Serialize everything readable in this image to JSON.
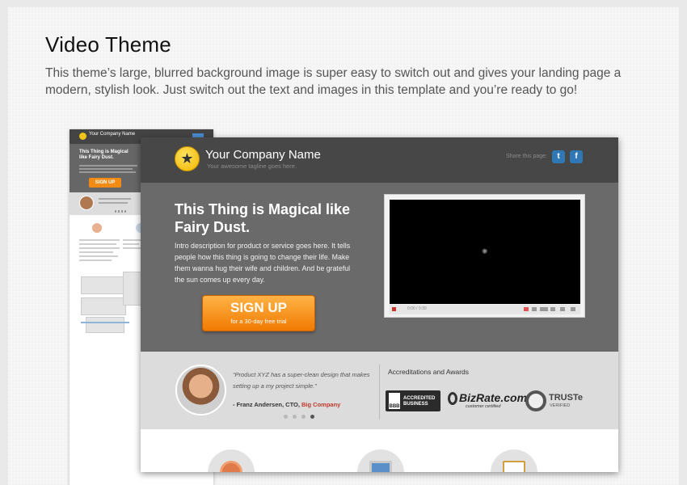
{
  "heading": "Video Theme",
  "description": "This theme’s large, blurred background image is super easy to switch out and gives your landing page a modern, stylish look. Just switch out the text and images in this template and you’re ready to go!",
  "mini_preview": {
    "company": "Your Company Name",
    "title": "This Thing is Magical like Fairy Dust.",
    "signup": "SIGN UP"
  },
  "preview": {
    "company_name": "Your Company Name",
    "tagline": "Your awesome tagline goes here.",
    "share_label": "Share this page:",
    "share_icons": [
      "twitter-icon",
      "facebook-icon"
    ],
    "share_glyphs": [
      "t",
      "f"
    ],
    "hero_title": "This Thing is Magical like Fairy Dust.",
    "hero_description": "Intro description for product or service goes here. It tells people how this thing is going to change their life. Make them wanna hug their wife and children. And be grateful the sun comes up every day.",
    "signup_label": "SIGN UP",
    "signup_sublabel": "for a 30-day free trial",
    "video_time": "0:00 / 0:30",
    "testimonial_quote": "“Product XYZ has a super-clean design that makes setting up a my project simple.”",
    "testimonial_author": "- Franz Andersen, CTO, ",
    "testimonial_company": "Big Company",
    "awards_title": "Accreditations and Awards",
    "bbb_label": "ACCREDITED BUSINESS",
    "bbb_mark": "BBB",
    "bizrate_name": "BizRate.com",
    "bizrate_sub": "customer certified",
    "truste_name": "TRUSTe",
    "truste_sub": "VERIFIED"
  },
  "colors": {
    "header_bg": "#474747",
    "hero_bg": "#6a6a6a",
    "signup_orange": "#f28b14",
    "share_blue": "#2f77b5",
    "company_link": "#c0392b"
  }
}
